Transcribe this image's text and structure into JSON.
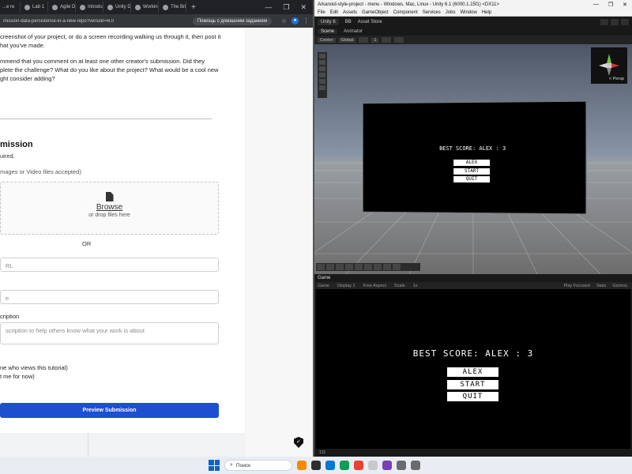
{
  "browser": {
    "tabs": [
      {
        "label": "...e re"
      },
      {
        "label": "Lab 1"
      },
      {
        "label": "Agile D"
      },
      {
        "label": "Introdu"
      },
      {
        "label": "Unity D"
      },
      {
        "label": "Workin"
      },
      {
        "label": "The Bri"
      }
    ],
    "new_tab_glyph": "+",
    "url": "mission-data-persistence-in-a-new-repo?version=6.0",
    "help_chip": "Помощь с домашним заданием",
    "window_controls": [
      "—",
      "❐",
      "✕"
    ]
  },
  "webpage": {
    "para1": [
      "creenshot of your project, or do a screen recording walking us through it, then post it",
      "hat you've made."
    ],
    "para2": [
      "mmend that you comment on at least one other creator's submission. Did they",
      "plete the challenge? What do you like about the project? What would be a cool new",
      "ght consider adding?"
    ],
    "submission_heading": "mission",
    "required_note": "uired.",
    "files_label": "mages or Video files accepted)",
    "browse_label": "Browse",
    "drop_text": "or drop files here",
    "or_text": "OR",
    "url_placeholder": "RL",
    "title_placeholder": "e",
    "description_label": "cription",
    "description_placeholder": "scription to help others know what your work is about",
    "visibility_label": "ne who views this tutorial)",
    "visibility_sub": "t me for now)",
    "preview_button": "Preview Submission"
  },
  "unity": {
    "title": "Arkanoid-style-project - menu - Windows, Mac, Linux - Unity 6.1 (6000.1.15f1) <DX11>",
    "window_controls": [
      "—",
      "❐",
      "✕"
    ],
    "menu": [
      "File",
      "Edit",
      "Assets",
      "GameObject",
      "Component",
      "Services",
      "Jobs",
      "Window",
      "Help"
    ],
    "toolbar": {
      "account": "Unity 6",
      "org": "BB",
      "store": "Asset Store"
    },
    "scene_tabs": [
      "Scene",
      "Animator"
    ],
    "scene_toolbar": {
      "pivot": "Center",
      "space": "Global",
      "snap": "1"
    },
    "gizmo_label": "< Persp",
    "game_tab": "Game",
    "game_toolbar": {
      "mode": "Game",
      "display": "Display 1",
      "aspect": "Free Aspect",
      "scale_label": "Scale",
      "scale_value": "1x",
      "play": "Play Focused",
      "stats": "Stats",
      "gizmos": "Gizmos"
    },
    "menu_ui": {
      "best_score": "BEST SCORE: ALEX : 3",
      "name_field": "ALEX",
      "start_button": "START",
      "quit_button": "QUIT"
    },
    "status": "111"
  },
  "taskbar": {
    "search_placeholder": "Поиск",
    "app_colors": [
      "#f28b00",
      "#2d2d2d",
      "#0078d4",
      "#0f9d58",
      "#e94235",
      "#c9c9c9",
      "#7a3fb8",
      "#6b6b6b",
      "#6b6b6b"
    ]
  }
}
